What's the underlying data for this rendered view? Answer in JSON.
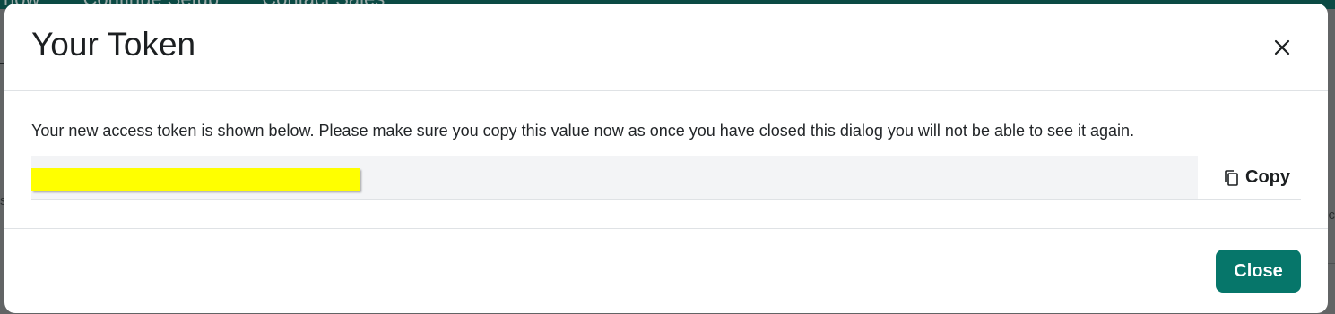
{
  "background": {
    "nav_items": [
      "now",
      "Continue Setup",
      "Contact Sales"
    ]
  },
  "modal": {
    "title": "Your Token",
    "close_icon": "close-icon",
    "description": "Your new access token is shown below. Please make sure you copy this value now as once you have closed this dialog you will not be able to see it again.",
    "token": {
      "value_redacted": true,
      "highlight_color": "#ffff00"
    },
    "copy_button": {
      "icon": "copy-icon",
      "label": "Copy"
    },
    "footer": {
      "close_label": "Close"
    }
  },
  "colors": {
    "primary": "#06766a",
    "top_bar": "#0b4a44",
    "token_field_bg": "#f3f4f6"
  }
}
